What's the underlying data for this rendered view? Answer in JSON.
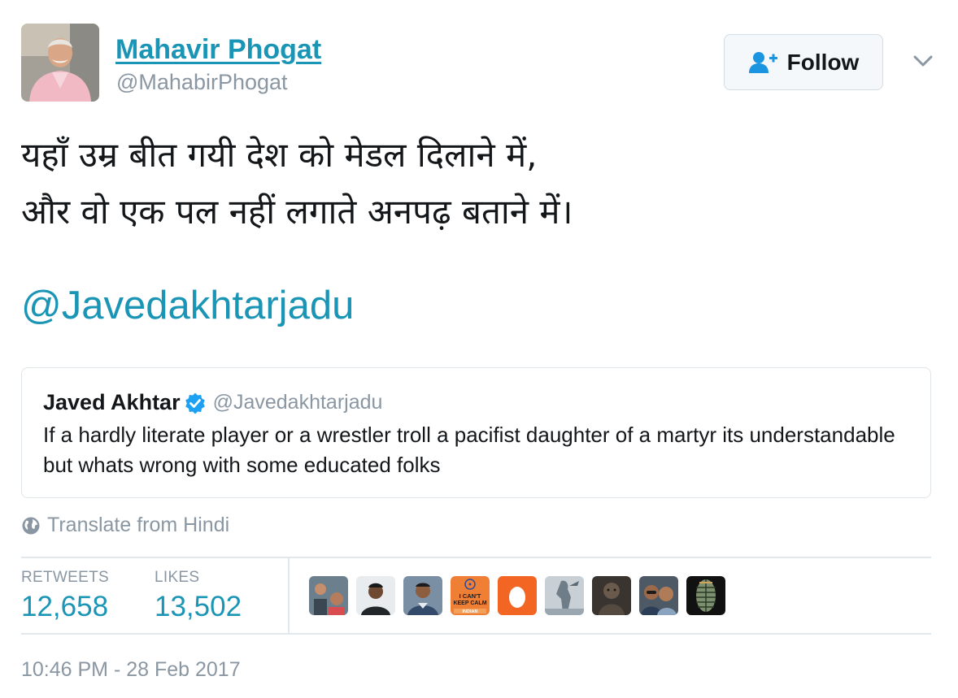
{
  "tweet": {
    "author": {
      "name": "Mahavir Phogat",
      "handle": "@MahabirPhogat"
    },
    "follow_label": "Follow",
    "text_lines": [
      "यहाँ उम्र बीत गयी देश को मेडल दिलाने में,",
      "और वो एक पल नहीं लगाते अनपढ़ बताने में।"
    ],
    "mention": "@Javedakhtarjadu",
    "quoted": {
      "name": "Javed Akhtar",
      "handle": "@Javedakhtarjadu",
      "text": "If a hardly literate player or a wrestler troll a pacifist daughter of a martyr its understandable but whats wrong with some educated folks"
    },
    "translate_label": "Translate from Hindi",
    "stats": {
      "retweets_label": "RETWEETS",
      "retweets_value": "12,658",
      "likes_label": "LIKES",
      "likes_value": "13,502"
    },
    "liker_avatars": [
      "avatar-1",
      "avatar-2",
      "avatar-3",
      "avatar-4",
      "avatar-5",
      "avatar-6",
      "avatar-7",
      "avatar-8",
      "avatar-9"
    ],
    "liker_badge": {
      "line1": "I CAN'T",
      "line2": "KEEP CALM",
      "line3": "INDIAN"
    },
    "timestamp": "10:46 PM - 28 Feb 2017"
  },
  "colors": {
    "link": "#1b95b5",
    "muted": "#8a97a3",
    "text": "#14171a",
    "border": "#e1e8ed"
  }
}
